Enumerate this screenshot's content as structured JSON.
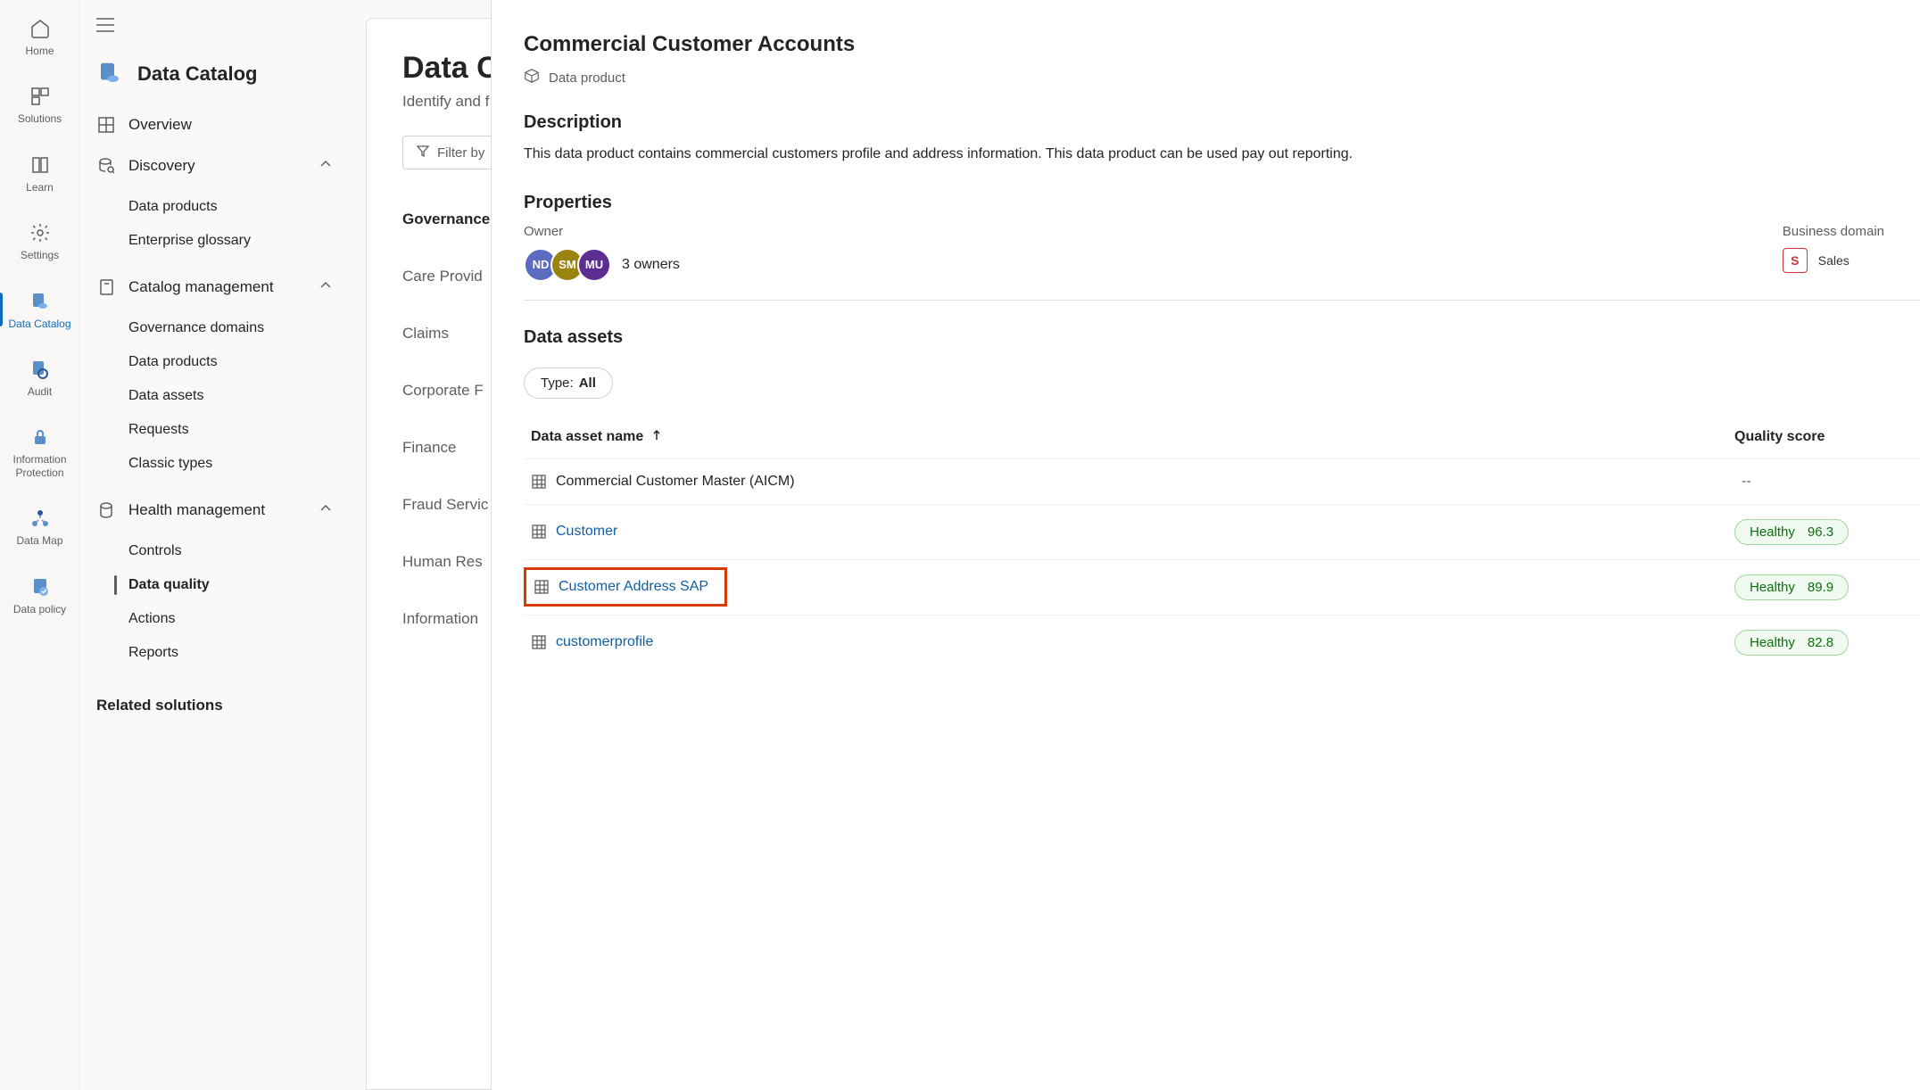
{
  "rail": {
    "home": "Home",
    "solutions": "Solutions",
    "learn": "Learn",
    "settings": "Settings",
    "data_catalog": "Data Catalog",
    "audit": "Audit",
    "info_protection": "Information Protection",
    "data_map": "Data Map",
    "data_policy": "Data policy"
  },
  "nav": {
    "title": "Data Catalog",
    "overview": "Overview",
    "discovery": {
      "label": "Discovery",
      "items": [
        "Data products",
        "Enterprise glossary"
      ]
    },
    "catalog": {
      "label": "Catalog management",
      "items": [
        "Governance domains",
        "Data products",
        "Data assets",
        "Requests",
        "Classic types"
      ]
    },
    "health": {
      "label": "Health management",
      "items": [
        "Controls",
        "Data quality",
        "Actions",
        "Reports"
      ]
    },
    "related": "Related solutions"
  },
  "main": {
    "title_partial": "Data C",
    "subtitle_partial": "Identify and f",
    "filter_partial": "Filter by",
    "gov_items": [
      "Governance",
      "Care Provid",
      "Claims",
      "Corporate F",
      "Finance",
      "Fraud Servic",
      "Human Res",
      "Information"
    ]
  },
  "panel": {
    "title": "Commercial Customer Accounts",
    "type": "Data product",
    "description_h": "Description",
    "description": "This data product contains commercial customers profile and address information. This data product can be used pay out reporting.",
    "properties_h": "Properties",
    "owner_label": "Owner",
    "owner_initials": [
      "ND",
      "SM",
      "MU"
    ],
    "owner_count": "3 owners",
    "domain_label": "Business domain",
    "domain_initial": "S",
    "domain_name": "Sales",
    "assets_h": "Data assets",
    "type_filter_prefix": "Type: ",
    "type_filter_value": "All",
    "col_name": "Data asset name",
    "col_score": "Quality score",
    "assets": [
      {
        "name": "Commercial Customer Master (AICM)",
        "link": false,
        "health": null,
        "score": "--"
      },
      {
        "name": "Customer",
        "link": true,
        "health": "Healthy",
        "score": "96.3"
      },
      {
        "name": "Customer Address SAP",
        "link": true,
        "health": "Healthy",
        "score": "89.9",
        "highlighted": true
      },
      {
        "name": "customerprofile",
        "link": true,
        "health": "Healthy",
        "score": "82.8"
      }
    ]
  }
}
